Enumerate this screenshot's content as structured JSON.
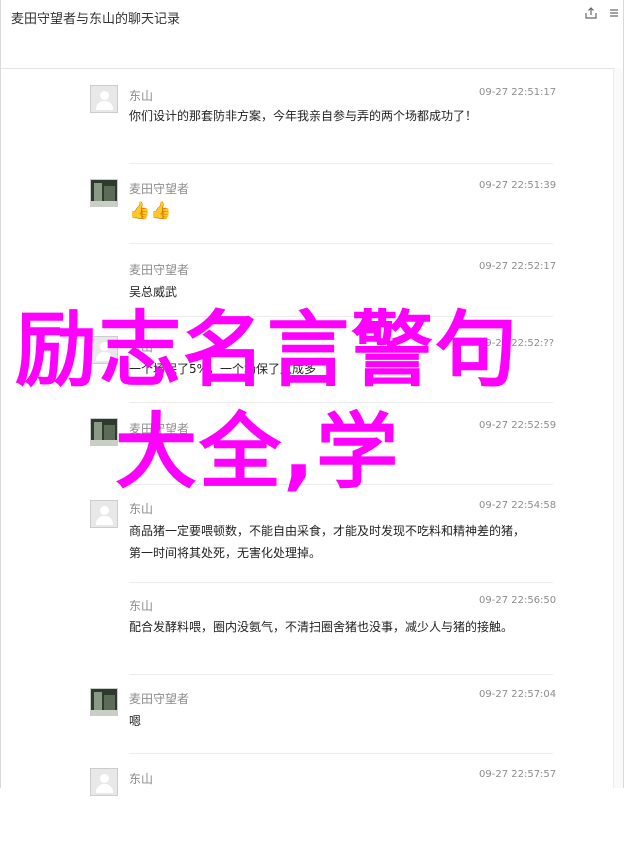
{
  "window": {
    "title": "麦田守望者与东山的聊天记录"
  },
  "messages": [
    {
      "sender": "东山",
      "time": "09-27 22:51:17",
      "text": "你们设计的那套防非方案，今年我亲自参与弄的两个场都成功了！",
      "avatar": "default"
    },
    {
      "sender": "麦田守望者",
      "time": "09-27 22:51:39",
      "text": "👍👍",
      "avatar": "photo"
    },
    {
      "sender": "麦田守望者",
      "time": "09-27 22:52:17",
      "text": "吴总威武",
      "avatar": "none"
    },
    {
      "sender": "东山",
      "time": "09-27 22:52:??",
      "text": "一个场保了5%，一个场保了八成多",
      "avatar": "default"
    },
    {
      "sender": "麦田守望者",
      "time": "09-27 22:52:59",
      "text": "",
      "avatar": "photo"
    },
    {
      "sender": "东山",
      "time": "09-27 22:54:58",
      "text": "商品猪一定要喂顿数，不能自由采食，才能及时发现不吃料和精神差的猪，第一时间将其处死，无害化处理掉。",
      "avatar": "default"
    },
    {
      "sender": "东山",
      "time": "09-27 22:56:50",
      "text": "配合发酵料喂，圈内没氨气，不清扫圈舍猪也没事，减少人与猪的接触。",
      "avatar": "none"
    },
    {
      "sender": "麦田守望者",
      "time": "09-27 22:57:04",
      "text": "嗯",
      "avatar": "photo"
    },
    {
      "sender": "东山",
      "time": "09-27 22:57:57",
      "text": "",
      "avatar": "default"
    }
  ],
  "overlay": {
    "line1": "励志名言警句",
    "line2": "大全,学"
  },
  "colors": {
    "overlay": "#ff00ff",
    "meta": "#8c8c8c"
  },
  "icons": {
    "share": "share-icon",
    "more": "more-icon"
  }
}
